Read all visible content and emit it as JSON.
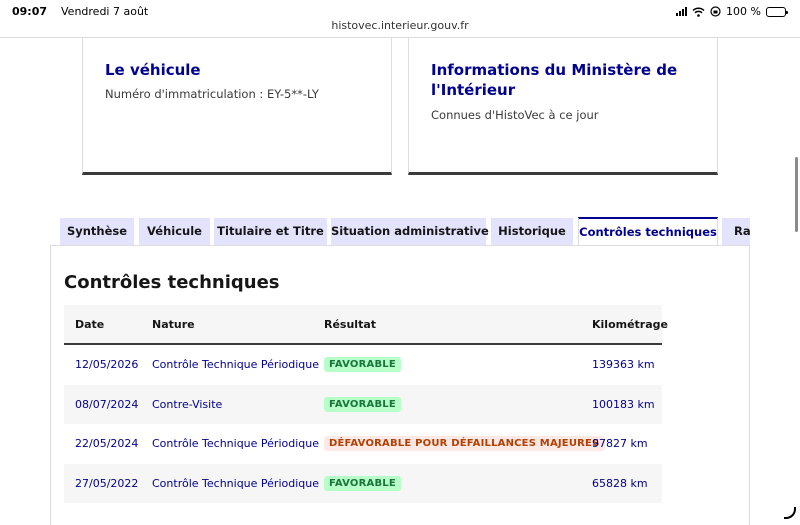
{
  "status_bar": {
    "time": "09:07",
    "date": "Vendredi 7 août",
    "battery": "100 %",
    "battery_level": 1.0
  },
  "browser": {
    "url": "histovec.interieur.gouv.fr"
  },
  "cards": [
    {
      "title": "Le véhicule",
      "description": "Numéro d'immatriculation : EY-5**-LY"
    },
    {
      "title_line1": "Informations du Ministère de",
      "title_line2": "l'Intérieur",
      "description": "Connues d'HistoVec à ce jour"
    }
  ],
  "tabs": [
    {
      "label": "Synthèse"
    },
    {
      "label": "Véhicule"
    },
    {
      "label": "Titulaire et Titre"
    },
    {
      "label": "Situation administrative"
    },
    {
      "label": "Historique"
    },
    {
      "label": "Contrôles techniques",
      "active": true
    },
    {
      "label": "Rap"
    }
  ],
  "panel": {
    "title": "Contrôles techniques",
    "table": {
      "headers": [
        "Date",
        "Nature",
        "Résultat",
        "Kilométrage"
      ],
      "rows": [
        {
          "date": "12/05/2026",
          "nature": "Contrôle Technique Périodique",
          "result": "FAVORABLE",
          "status": "ok",
          "km": "139363 km"
        },
        {
          "date": "08/07/2024",
          "nature": "Contre-Visite",
          "result": "FAVORABLE",
          "status": "ok",
          "km": "100183 km"
        },
        {
          "date": "22/05/2024",
          "nature": "Contrôle Technique Périodique",
          "result": "DÉFAVORABLE POUR DÉFAILLANCES MAJEURES",
          "status": "ko",
          "km": "97827 km"
        },
        {
          "date": "27/05/2022",
          "nature": "Contrôle Technique Périodique",
          "result": "FAVORABLE",
          "status": "ok",
          "km": "65828 km"
        }
      ]
    }
  },
  "colors": {
    "primary": "#000091",
    "tab_background": "#e3e3fd",
    "success_bg": "#b8fec9",
    "success_text": "#18753c",
    "error_bg": "#ffe9e6",
    "error_text": "#b34000"
  }
}
